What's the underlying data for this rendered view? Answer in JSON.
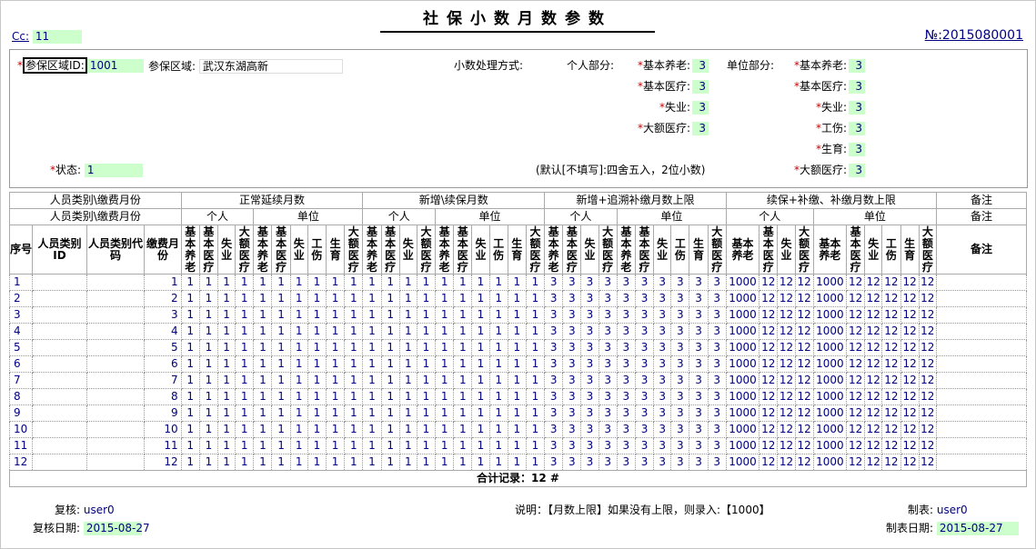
{
  "title": "社保小数月数参数",
  "cc_label": "Cc:",
  "cc_value": "11",
  "doc_no": "№:2015080001",
  "params": {
    "area_id_label": "参保区域ID:",
    "area_id_value": "1001",
    "area_name_label": "参保区域:",
    "area_name_value": "武汉东湖高新",
    "status_label": "状态:",
    "status_value": "1",
    "rounding_label": "小数处理方式:",
    "rounding_note": "(默认[不填写]:四舍五入，2位小数)",
    "personal_label": "个人部分:",
    "company_label": "单位部分:",
    "personal_items": [
      {
        "label": "基本养老:",
        "value": "3"
      },
      {
        "label": "基本医疗:",
        "value": "3"
      },
      {
        "label": "失业:",
        "value": "3"
      },
      {
        "label": "大额医疗:",
        "value": "3"
      }
    ],
    "company_items": [
      {
        "label": "基本养老:",
        "value": "3"
      },
      {
        "label": "基本医疗:",
        "value": "3"
      },
      {
        "label": "失业:",
        "value": "3"
      },
      {
        "label": "工伤:",
        "value": "3"
      },
      {
        "label": "生育:",
        "value": "3"
      },
      {
        "label": "大额医疗:",
        "value": "3"
      }
    ]
  },
  "table": {
    "group_headers": [
      "人员类别\\缴费月份",
      "正常延续月数",
      "新增\\续保月数",
      "新增+追溯补缴月数上限",
      "续保+补缴、补缴月数上限",
      "备注"
    ],
    "sub_headers": [
      "人员类别\\缴费月份",
      "个人",
      "单位",
      "个人",
      "单位",
      "个人",
      "单位",
      "个人",
      "单位",
      "备注"
    ],
    "col_headers": [
      "序号",
      "人员类别ID",
      "人员类别代码",
      "缴费月份"
    ],
    "personal_cols": [
      "基本养老",
      "基本医疗",
      "失业",
      "大额医疗"
    ],
    "company_cols": [
      "基本养老",
      "基本医疗",
      "失业",
      "工伤",
      "生育",
      "大额医疗"
    ],
    "last_personal_cols": [
      "基本养老",
      "基本医疗",
      "失业",
      "大额医疗"
    ],
    "last_company_cols": [
      "基本养老",
      "基本医疗",
      "失业",
      "工伤",
      "生育",
      "大额医疗"
    ],
    "remark_header": "备注",
    "rows": [
      {
        "seq": "1",
        "month": "1",
        "g1": [
          "1",
          "1",
          "1",
          "1",
          "1",
          "1",
          "1",
          "1",
          "1",
          "1"
        ],
        "g2": [
          "1",
          "1",
          "1",
          "1",
          "1",
          "1",
          "1",
          "1",
          "1",
          "1"
        ],
        "g3": [
          "3",
          "3",
          "3",
          "3",
          "3",
          "3",
          "3",
          "3",
          "3",
          "3"
        ],
        "g4": [
          "1000",
          "12",
          "12",
          "12",
          "1000",
          "12",
          "12",
          "12",
          "12",
          "12"
        ]
      },
      {
        "seq": "2",
        "month": "2",
        "g1": [
          "1",
          "1",
          "1",
          "1",
          "1",
          "1",
          "1",
          "1",
          "1",
          "1"
        ],
        "g2": [
          "1",
          "1",
          "1",
          "1",
          "1",
          "1",
          "1",
          "1",
          "1",
          "1"
        ],
        "g3": [
          "3",
          "3",
          "3",
          "3",
          "3",
          "3",
          "3",
          "3",
          "3",
          "3"
        ],
        "g4": [
          "1000",
          "12",
          "12",
          "12",
          "1000",
          "12",
          "12",
          "12",
          "12",
          "12"
        ]
      },
      {
        "seq": "3",
        "month": "3",
        "g1": [
          "1",
          "1",
          "1",
          "1",
          "1",
          "1",
          "1",
          "1",
          "1",
          "1"
        ],
        "g2": [
          "1",
          "1",
          "1",
          "1",
          "1",
          "1",
          "1",
          "1",
          "1",
          "1"
        ],
        "g3": [
          "3",
          "3",
          "3",
          "3",
          "3",
          "3",
          "3",
          "3",
          "3",
          "3"
        ],
        "g4": [
          "1000",
          "12",
          "12",
          "12",
          "1000",
          "12",
          "12",
          "12",
          "12",
          "12"
        ]
      },
      {
        "seq": "4",
        "month": "4",
        "g1": [
          "1",
          "1",
          "1",
          "1",
          "1",
          "1",
          "1",
          "1",
          "1",
          "1"
        ],
        "g2": [
          "1",
          "1",
          "1",
          "1",
          "1",
          "1",
          "1",
          "1",
          "1",
          "1"
        ],
        "g3": [
          "3",
          "3",
          "3",
          "3",
          "3",
          "3",
          "3",
          "3",
          "3",
          "3"
        ],
        "g4": [
          "1000",
          "12",
          "12",
          "12",
          "1000",
          "12",
          "12",
          "12",
          "12",
          "12"
        ]
      },
      {
        "seq": "5",
        "month": "5",
        "g1": [
          "1",
          "1",
          "1",
          "1",
          "1",
          "1",
          "1",
          "1",
          "1",
          "1"
        ],
        "g2": [
          "1",
          "1",
          "1",
          "1",
          "1",
          "1",
          "1",
          "1",
          "1",
          "1"
        ],
        "g3": [
          "3",
          "3",
          "3",
          "3",
          "3",
          "3",
          "3",
          "3",
          "3",
          "3"
        ],
        "g4": [
          "1000",
          "12",
          "12",
          "12",
          "1000",
          "12",
          "12",
          "12",
          "12",
          "12"
        ]
      },
      {
        "seq": "6",
        "month": "6",
        "g1": [
          "1",
          "1",
          "1",
          "1",
          "1",
          "1",
          "1",
          "1",
          "1",
          "1"
        ],
        "g2": [
          "1",
          "1",
          "1",
          "1",
          "1",
          "1",
          "1",
          "1",
          "1",
          "1"
        ],
        "g3": [
          "3",
          "3",
          "3",
          "3",
          "3",
          "3",
          "3",
          "3",
          "3",
          "3"
        ],
        "g4": [
          "1000",
          "12",
          "12",
          "12",
          "1000",
          "12",
          "12",
          "12",
          "12",
          "12"
        ]
      },
      {
        "seq": "7",
        "month": "7",
        "g1": [
          "1",
          "1",
          "1",
          "1",
          "1",
          "1",
          "1",
          "1",
          "1",
          "1"
        ],
        "g2": [
          "1",
          "1",
          "1",
          "1",
          "1",
          "1",
          "1",
          "1",
          "1",
          "1"
        ],
        "g3": [
          "3",
          "3",
          "3",
          "3",
          "3",
          "3",
          "3",
          "3",
          "3",
          "3"
        ],
        "g4": [
          "1000",
          "12",
          "12",
          "12",
          "1000",
          "12",
          "12",
          "12",
          "12",
          "12"
        ]
      },
      {
        "seq": "8",
        "month": "8",
        "g1": [
          "1",
          "1",
          "1",
          "1",
          "1",
          "1",
          "1",
          "1",
          "1",
          "1"
        ],
        "g2": [
          "1",
          "1",
          "1",
          "1",
          "1",
          "1",
          "1",
          "1",
          "1",
          "1"
        ],
        "g3": [
          "3",
          "3",
          "3",
          "3",
          "3",
          "3",
          "3",
          "3",
          "3",
          "3"
        ],
        "g4": [
          "1000",
          "12",
          "12",
          "12",
          "1000",
          "12",
          "12",
          "12",
          "12",
          "12"
        ]
      },
      {
        "seq": "9",
        "month": "9",
        "g1": [
          "1",
          "1",
          "1",
          "1",
          "1",
          "1",
          "1",
          "1",
          "1",
          "1"
        ],
        "g2": [
          "1",
          "1",
          "1",
          "1",
          "1",
          "1",
          "1",
          "1",
          "1",
          "1"
        ],
        "g3": [
          "3",
          "3",
          "3",
          "3",
          "3",
          "3",
          "3",
          "3",
          "3",
          "3"
        ],
        "g4": [
          "1000",
          "12",
          "12",
          "12",
          "1000",
          "12",
          "12",
          "12",
          "12",
          "12"
        ]
      },
      {
        "seq": "10",
        "month": "10",
        "g1": [
          "1",
          "1",
          "1",
          "1",
          "1",
          "1",
          "1",
          "1",
          "1",
          "1"
        ],
        "g2": [
          "1",
          "1",
          "1",
          "1",
          "1",
          "1",
          "1",
          "1",
          "1",
          "1"
        ],
        "g3": [
          "3",
          "3",
          "3",
          "3",
          "3",
          "3",
          "3",
          "3",
          "3",
          "3"
        ],
        "g4": [
          "1000",
          "12",
          "12",
          "12",
          "1000",
          "12",
          "12",
          "12",
          "12",
          "12"
        ]
      },
      {
        "seq": "11",
        "month": "11",
        "g1": [
          "1",
          "1",
          "1",
          "1",
          "1",
          "1",
          "1",
          "1",
          "1",
          "1"
        ],
        "g2": [
          "1",
          "1",
          "1",
          "1",
          "1",
          "1",
          "1",
          "1",
          "1",
          "1"
        ],
        "g3": [
          "3",
          "3",
          "3",
          "3",
          "3",
          "3",
          "3",
          "3",
          "3",
          "3"
        ],
        "g4": [
          "1000",
          "12",
          "12",
          "12",
          "1000",
          "12",
          "12",
          "12",
          "12",
          "12"
        ]
      },
      {
        "seq": "12",
        "month": "12",
        "g1": [
          "1",
          "1",
          "1",
          "1",
          "1",
          "1",
          "1",
          "1",
          "1",
          "1"
        ],
        "g2": [
          "1",
          "1",
          "1",
          "1",
          "1",
          "1",
          "1",
          "1",
          "1",
          "1"
        ],
        "g3": [
          "3",
          "3",
          "3",
          "3",
          "3",
          "3",
          "3",
          "3",
          "3",
          "3"
        ],
        "g4": [
          "1000",
          "12",
          "12",
          "12",
          "1000",
          "12",
          "12",
          "12",
          "12",
          "12"
        ]
      }
    ],
    "total_text": "合计记录：12 #"
  },
  "footer": {
    "reviewer_label": "复核:",
    "reviewer_value": "user0",
    "review_date_label": "复核日期:",
    "review_date_value": "2015-08-27",
    "note": "说明：【月数上限】如果没有上限，则录入:【1000】",
    "maker_label": "制表:",
    "maker_value": "user0",
    "make_date_label": "制表日期:",
    "make_date_value": "2015-08-27"
  },
  "colors": {
    "value_bg": "#ccffcc",
    "value_text": "#000080",
    "required": "#cc0000"
  }
}
